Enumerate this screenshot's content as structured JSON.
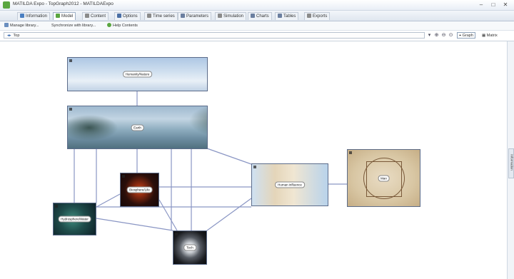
{
  "window": {
    "title": "MATILDA Expo - TopGraph2012 - MATILDAExpo",
    "controls": {
      "minimize": "–",
      "maximize": "□",
      "close": "✕"
    }
  },
  "tabs": [
    {
      "label": "Information",
      "icon": "info-icon",
      "color": "#4a7fc1"
    },
    {
      "label": "Model",
      "icon": "model-icon",
      "color": "#5aa640",
      "active": true
    },
    {
      "label": "Content",
      "icon": "content-icon",
      "color": "#8a8a8a"
    },
    {
      "label": "Options",
      "icon": "options-icon",
      "color": "#4a6fa5"
    },
    {
      "label": "Time series",
      "icon": "time-series-icon",
      "color": "#8a8a8a"
    },
    {
      "label": "Parameters",
      "icon": "parameters-icon",
      "color": "#6b7fa0"
    },
    {
      "label": "Simulation",
      "icon": "simulation-icon",
      "color": "#8a8a8a"
    },
    {
      "label": "Charts",
      "icon": "charts-icon",
      "color": "#6b7fa0"
    },
    {
      "label": "Tables",
      "icon": "tables-icon",
      "color": "#6b7fa0"
    },
    {
      "label": "Exports",
      "icon": "exports-icon",
      "color": "#8a8a8a"
    }
  ],
  "toolbar": {
    "manage_label": "Manage library...",
    "synchronize_label": "Synchronize with library...",
    "help_label": "Help Contents"
  },
  "navbar": {
    "path": "Top",
    "graph_label": "Graph",
    "matrix_label": "Matrix"
  },
  "sidepanel": {
    "tab_label": "Information"
  },
  "graph": {
    "nodes": [
      {
        "id": "humanity",
        "label": "Humanity/Nature"
      },
      {
        "id": "earth",
        "label": "Earth"
      },
      {
        "id": "bio",
        "label": "Biosphere/Life"
      },
      {
        "id": "hydro",
        "label": "Hydrosphere/Water"
      },
      {
        "id": "tech",
        "label": "Tech"
      },
      {
        "id": "influence",
        "label": "Human influence"
      },
      {
        "id": "vitruvian",
        "label": "Man"
      }
    ]
  },
  "colors": {
    "edge": "#8a96c4",
    "node_border": "#5c6c8a",
    "active_tab": "#ffffff"
  }
}
